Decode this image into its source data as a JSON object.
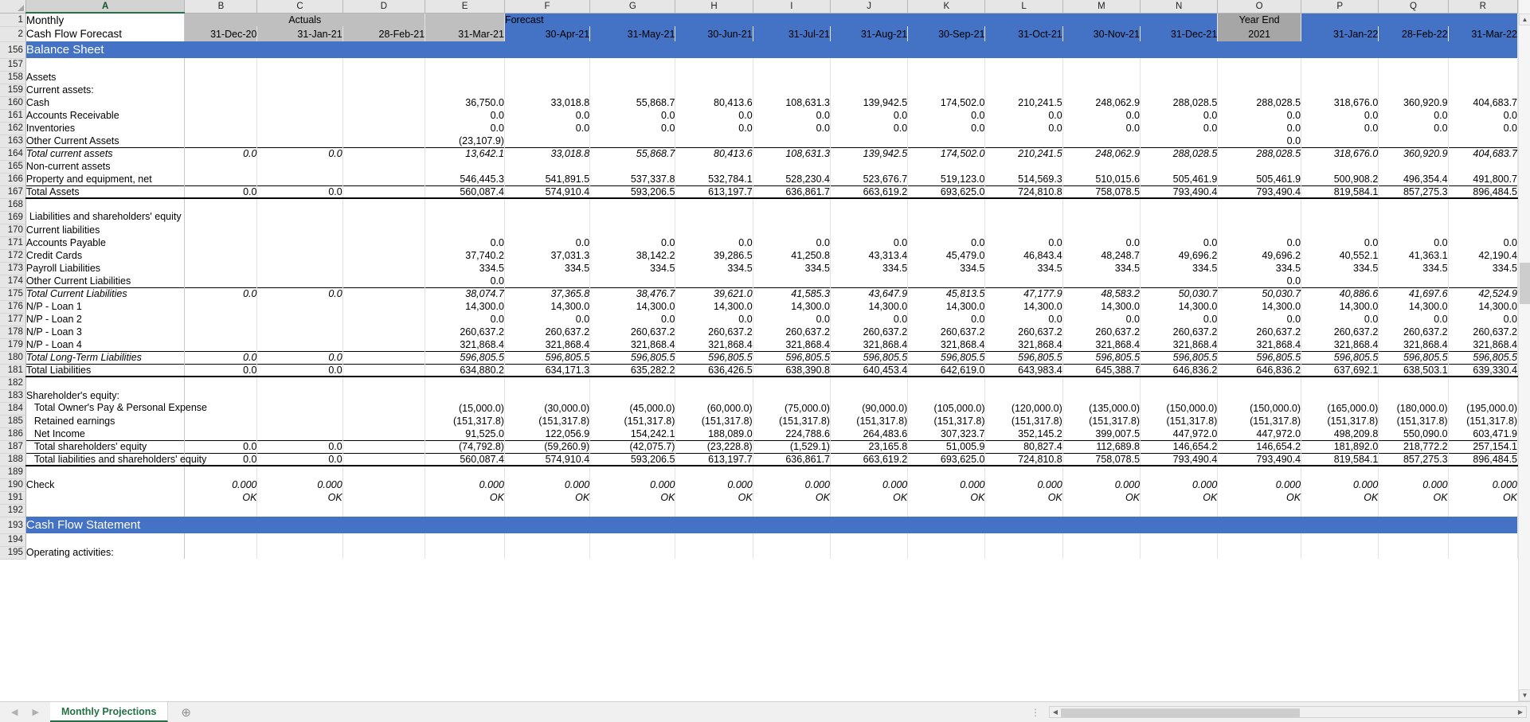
{
  "app": {
    "type": "spreadsheet",
    "accent_blue": "#4472c4",
    "input_blue": "#4472a8",
    "ok_green": "#21a366",
    "year_end_gray": "#a6a6a6",
    "actuals_gray": "#bfbfbf"
  },
  "column_letters": [
    "A",
    "B",
    "C",
    "D",
    "E",
    "F",
    "G",
    "H",
    "I",
    "J",
    "K",
    "L",
    "M",
    "N",
    "O",
    "P",
    "Q",
    "R"
  ],
  "header": {
    "row1": {
      "a": "Monthly",
      "actuals_label": "Actuals",
      "forecast_label": "Forecast",
      "year_end_label": "Year End"
    },
    "row2": {
      "a": "Cash Flow Forecast",
      "year_end_value": "2021",
      "dates": [
        "31-Dec-20",
        "31-Jan-21",
        "28-Feb-21",
        "31-Mar-21",
        "30-Apr-21",
        "31-May-21",
        "30-Jun-21",
        "31-Jul-21",
        "31-Aug-21",
        "30-Sep-21",
        "31-Oct-21",
        "30-Nov-21",
        "31-Dec-21",
        "31-Jan-22",
        "28-Feb-22",
        "31-Mar-22"
      ]
    }
  },
  "banners": {
    "balance_sheet": "Balance Sheet",
    "cash_flow_statement": "Cash Flow Statement"
  },
  "row_numbers": [
    156,
    157,
    158,
    159,
    160,
    161,
    162,
    163,
    164,
    165,
    166,
    167,
    168,
    169,
    170,
    171,
    172,
    173,
    174,
    175,
    176,
    177,
    178,
    179,
    180,
    181,
    182,
    183,
    184,
    185,
    186,
    187,
    188,
    189,
    190,
    191,
    192,
    193,
    194,
    195
  ],
  "labels": {
    "assets": "Assets",
    "current_assets": "Current assets:",
    "cash": "Cash",
    "accounts_receivable": "Accounts Receivable",
    "inventories": "Inventories",
    "other_current_assets": "Other Current Assets",
    "total_current_assets": "Total current assets",
    "non_current_assets": "Non-current assets",
    "property_equipment": "Property and equipment, net",
    "total_assets": "Total Assets",
    "liab_and_equity": "Liabilities and shareholders' equity",
    "current_liabilities": "Current liabilities",
    "accounts_payable": "Accounts Payable",
    "credit_cards": "Credit Cards",
    "payroll_liabilities": "Payroll Liabilities",
    "other_current_liabilities": "Other Current Liabilities",
    "total_current_liabilities": "Total Current Liabilities",
    "np_loan_1": "N/P - Loan 1",
    "np_loan_2": "N/P - Loan 2",
    "np_loan_3": "N/P - Loan 3",
    "np_loan_4": "N/P - Loan 4",
    "total_long_term_liabilities": "Total Long-Term Liabilities",
    "total_liabilities": "Total Liabilities",
    "shareholders_equity_hdr": "Shareholder's equity:",
    "owners_pay": "Total Owner's Pay & Personal Expense",
    "retained_earnings": "Retained earnings",
    "net_income": "Net Income",
    "total_shareholders_equity": "Total shareholders' equity",
    "total_liab_and_equity": "Total liabilities and shareholders' equity",
    "check": "Check",
    "operating_activities": "Operating activities:"
  },
  "chart_data": {
    "type": "table",
    "title": "Monthly Cash Flow Forecast — Balance Sheet",
    "columns": [
      "B 31-Dec-20",
      "C 31-Jan-21",
      "D 28-Feb-21",
      "E 31-Mar-21",
      "F 30-Apr-21",
      "G 31-May-21",
      "H 30-Jun-21",
      "I 31-Jul-21",
      "J 31-Aug-21",
      "K 30-Sep-21",
      "L 31-Oct-21",
      "M 30-Nov-21",
      "N 31-Dec-21",
      "O Year End 2021",
      "P 31-Jan-22",
      "Q 28-Feb-22",
      "R 31-Mar-22"
    ],
    "rows": {
      "cash": [
        "",
        "",
        "",
        "36,750.0",
        "33,018.8",
        "55,868.7",
        "80,413.6",
        "108,631.3",
        "139,942.5",
        "174,502.0",
        "210,241.5",
        "248,062.9",
        "288,028.5",
        "288,028.5",
        "318,676.0",
        "360,920.9",
        "404,683.7"
      ],
      "accounts_receivable": [
        "",
        "",
        "",
        "0.0",
        "0.0",
        "0.0",
        "0.0",
        "0.0",
        "0.0",
        "0.0",
        "0.0",
        "0.0",
        "0.0",
        "0.0",
        "0.0",
        "0.0",
        "0.0"
      ],
      "inventories": [
        "",
        "",
        "",
        "0.0",
        "0.0",
        "0.0",
        "0.0",
        "0.0",
        "0.0",
        "0.0",
        "0.0",
        "0.0",
        "0.0",
        "0.0",
        "0.0",
        "0.0",
        "0.0"
      ],
      "other_current_assets": [
        "",
        "",
        "",
        "(23,107.9)",
        "",
        "",
        "",
        "",
        "",
        "",
        "",
        "",
        "",
        "0.0",
        "",
        "",
        ""
      ],
      "total_current_assets": [
        "0.0",
        "0.0",
        "",
        "13,642.1",
        "33,018.8",
        "55,868.7",
        "80,413.6",
        "108,631.3",
        "139,942.5",
        "174,502.0",
        "210,241.5",
        "248,062.9",
        "288,028.5",
        "288,028.5",
        "318,676.0",
        "360,920.9",
        "404,683.7"
      ],
      "property_equipment": [
        "",
        "",
        "",
        "546,445.3",
        "541,891.5",
        "537,337.8",
        "532,784.1",
        "528,230.4",
        "523,676.7",
        "519,123.0",
        "514,569.3",
        "510,015.6",
        "505,461.9",
        "505,461.9",
        "500,908.2",
        "496,354.4",
        "491,800.7"
      ],
      "total_assets": [
        "0.0",
        "0.0",
        "",
        "560,087.4",
        "574,910.4",
        "593,206.5",
        "613,197.7",
        "636,861.7",
        "663,619.2",
        "693,625.0",
        "724,810.8",
        "758,078.5",
        "793,490.4",
        "793,490.4",
        "819,584.1",
        "857,275.3",
        "896,484.5"
      ],
      "accounts_payable": [
        "",
        "",
        "",
        "0.0",
        "0.0",
        "0.0",
        "0.0",
        "0.0",
        "0.0",
        "0.0",
        "0.0",
        "0.0",
        "0.0",
        "0.0",
        "0.0",
        "0.0",
        "0.0"
      ],
      "credit_cards": [
        "",
        "",
        "",
        "37,740.2",
        "37,031.3",
        "38,142.2",
        "39,286.5",
        "41,250.8",
        "43,313.4",
        "45,479.0",
        "46,843.4",
        "48,248.7",
        "49,696.2",
        "49,696.2",
        "40,552.1",
        "41,363.1",
        "42,190.4"
      ],
      "payroll_liabilities": [
        "",
        "",
        "",
        "334.5",
        "334.5",
        "334.5",
        "334.5",
        "334.5",
        "334.5",
        "334.5",
        "334.5",
        "334.5",
        "334.5",
        "334.5",
        "334.5",
        "334.5",
        "334.5"
      ],
      "other_current_liabilities": [
        "",
        "",
        "",
        "0.0",
        "",
        "",
        "",
        "",
        "",
        "",
        "",
        "",
        "",
        "0.0",
        "",
        "",
        ""
      ],
      "total_current_liabilities": [
        "0.0",
        "0.0",
        "",
        "38,074.7",
        "37,365.8",
        "38,476.7",
        "39,621.0",
        "41,585.3",
        "43,647.9",
        "45,813.5",
        "47,177.9",
        "48,583.2",
        "50,030.7",
        "50,030.7",
        "40,886.6",
        "41,697.6",
        "42,524.9"
      ],
      "np_loan_1": [
        "",
        "",
        "",
        "14,300.0",
        "14,300.0",
        "14,300.0",
        "14,300.0",
        "14,300.0",
        "14,300.0",
        "14,300.0",
        "14,300.0",
        "14,300.0",
        "14,300.0",
        "14,300.0",
        "14,300.0",
        "14,300.0",
        "14,300.0"
      ],
      "np_loan_2": [
        "",
        "",
        "",
        "0.0",
        "0.0",
        "0.0",
        "0.0",
        "0.0",
        "0.0",
        "0.0",
        "0.0",
        "0.0",
        "0.0",
        "0.0",
        "0.0",
        "0.0",
        "0.0"
      ],
      "np_loan_3": [
        "",
        "",
        "",
        "260,637.2",
        "260,637.2",
        "260,637.2",
        "260,637.2",
        "260,637.2",
        "260,637.2",
        "260,637.2",
        "260,637.2",
        "260,637.2",
        "260,637.2",
        "260,637.2",
        "260,637.2",
        "260,637.2",
        "260,637.2"
      ],
      "np_loan_4": [
        "",
        "",
        "",
        "321,868.4",
        "321,868.4",
        "321,868.4",
        "321,868.4",
        "321,868.4",
        "321,868.4",
        "321,868.4",
        "321,868.4",
        "321,868.4",
        "321,868.4",
        "321,868.4",
        "321,868.4",
        "321,868.4",
        "321,868.4"
      ],
      "total_long_term_liabilities": [
        "0.0",
        "0.0",
        "",
        "596,805.5",
        "596,805.5",
        "596,805.5",
        "596,805.5",
        "596,805.5",
        "596,805.5",
        "596,805.5",
        "596,805.5",
        "596,805.5",
        "596,805.5",
        "596,805.5",
        "596,805.5",
        "596,805.5",
        "596,805.5"
      ],
      "total_liabilities": [
        "0.0",
        "0.0",
        "",
        "634,880.2",
        "634,171.3",
        "635,282.2",
        "636,426.5",
        "638,390.8",
        "640,453.4",
        "642,619.0",
        "643,983.4",
        "645,388.7",
        "646,836.2",
        "646,836.2",
        "637,692.1",
        "638,503.1",
        "639,330.4"
      ],
      "owners_pay": [
        "",
        "",
        "",
        "(15,000.0)",
        "(30,000.0)",
        "(45,000.0)",
        "(60,000.0)",
        "(75,000.0)",
        "(90,000.0)",
        "(105,000.0)",
        "(120,000.0)",
        "(135,000.0)",
        "(150,000.0)",
        "(150,000.0)",
        "(165,000.0)",
        "(180,000.0)",
        "(195,000.0)"
      ],
      "retained_earnings": [
        "",
        "",
        "",
        "(151,317.8)",
        "(151,317.8)",
        "(151,317.8)",
        "(151,317.8)",
        "(151,317.8)",
        "(151,317.8)",
        "(151,317.8)",
        "(151,317.8)",
        "(151,317.8)",
        "(151,317.8)",
        "(151,317.8)",
        "(151,317.8)",
        "(151,317.8)",
        "(151,317.8)"
      ],
      "net_income": [
        "",
        "",
        "",
        "91,525.0",
        "122,056.9",
        "154,242.1",
        "188,089.0",
        "224,788.6",
        "264,483.6",
        "307,323.7",
        "352,145.2",
        "399,007.5",
        "447,972.0",
        "447,972.0",
        "498,209.8",
        "550,090.0",
        "603,471.9"
      ],
      "total_shareholders_equity": [
        "0.0",
        "0.0",
        "",
        "(74,792.8)",
        "(59,260.9)",
        "(42,075.7)",
        "(23,228.8)",
        "(1,529.1)",
        "23,165.8",
        "51,005.9",
        "80,827.4",
        "112,689.8",
        "146,654.2",
        "146,654.2",
        "181,892.0",
        "218,772.2",
        "257,154.1"
      ],
      "total_liab_and_equity": [
        "0.0",
        "0.0",
        "",
        "560,087.4",
        "574,910.4",
        "593,206.5",
        "613,197.7",
        "636,861.7",
        "663,619.2",
        "693,625.0",
        "724,810.8",
        "758,078.5",
        "793,490.4",
        "793,490.4",
        "819,584.1",
        "857,275.3",
        "896,484.5"
      ],
      "check": [
        "0.000",
        "0.000",
        "",
        "0.000",
        "0.000",
        "0.000",
        "0.000",
        "0.000",
        "0.000",
        "0.000",
        "0.000",
        "0.000",
        "0.000",
        "0.000",
        "0.000",
        "0.000",
        "0.000"
      ],
      "ok": [
        "OK",
        "OK",
        "",
        "OK",
        "OK",
        "OK",
        "OK",
        "OK",
        "OK",
        "OK",
        "OK",
        "OK",
        "OK",
        "OK",
        "OK",
        "OK",
        "OK"
      ]
    }
  },
  "bottom_bar": {
    "prev_arrow": "◀",
    "next_arrow": "▶",
    "sheet_tab": "Monthly Projections",
    "add_sheet": "⊕",
    "grip": "⋮",
    "scroll_left": "◀",
    "scroll_right": "▶"
  },
  "vscroll": {
    "up": "▲",
    "down": "▼"
  }
}
